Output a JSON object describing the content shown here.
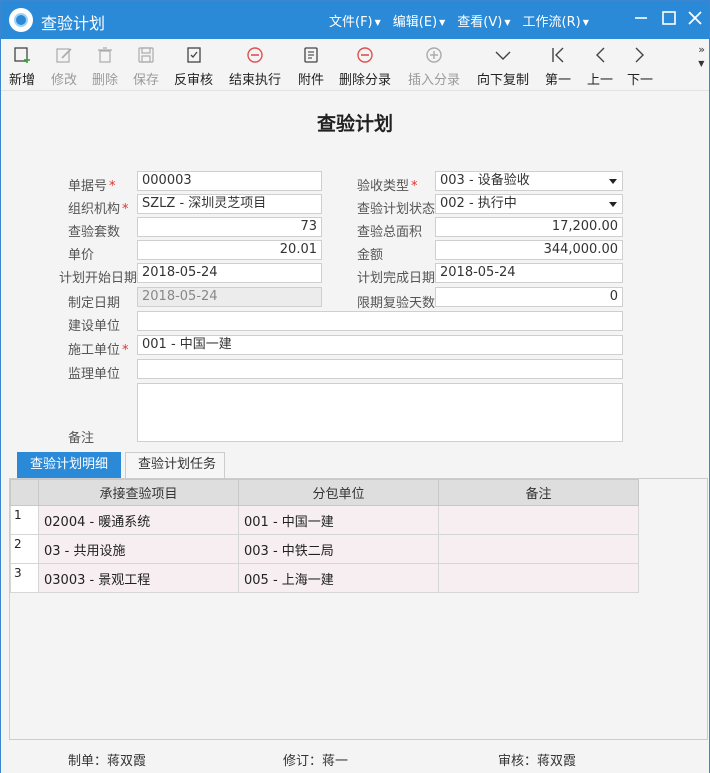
{
  "window": {
    "title": "查验计划"
  },
  "menu": [
    {
      "label": "文件(F)"
    },
    {
      "label": "编辑(E)"
    },
    {
      "label": "查看(V)"
    },
    {
      "label": "工作流(R)"
    }
  ],
  "toolbar": {
    "new": "新增",
    "edit": "修改",
    "delete": "删除",
    "save": "保存",
    "unaudit": "反审核",
    "end_exec": "结束执行",
    "attachment": "附件",
    "delete_entry": "删除分录",
    "insert_entry": "插入分录",
    "copy_down": "向下复制",
    "first": "第一",
    "prev": "上一",
    "next": "下一",
    "more": "»"
  },
  "form": {
    "title": "查验计划",
    "labels": {
      "doc_no": "单据号",
      "org": "组织机构",
      "set_count": "查验套数",
      "unit_price": "单价",
      "plan_start": "计划开始日期",
      "made_date": "制定日期",
      "build_unit": "建设单位",
      "construct_unit": "施工单位",
      "supervise_unit": "监理单位",
      "remark": "备注",
      "accept_type": "验收类型",
      "plan_status": "查验计划状态",
      "total_area": "查验总面积",
      "amount": "金额",
      "plan_end": "计划完成日期",
      "recheck_days": "限期复验天数"
    },
    "required_mark": "*",
    "values": {
      "doc_no": "000003",
      "org": "SZLZ - 深圳灵芝项目",
      "set_count": "73",
      "unit_price": "20.01",
      "plan_start": "2018-05-24",
      "made_date": "2018-05-24",
      "build_unit": "",
      "construct_unit": "001 - 中国一建",
      "supervise_unit": "",
      "remark": "",
      "accept_type": "003 - 设备验收",
      "plan_status": "002 - 执行中",
      "total_area": "17,200.00",
      "amount": "344,000.00",
      "plan_end": "2018-05-24",
      "recheck_days": "0"
    }
  },
  "tabs": [
    {
      "label": "查验计划明细",
      "active": true
    },
    {
      "label": "查验计划任务",
      "active": false
    }
  ],
  "grid": {
    "columns": [
      "承接查验项目",
      "分包单位",
      "备注"
    ],
    "rows": [
      {
        "num": "1",
        "item": "02004 - 暖通系统",
        "sub": "001 - 中国一建",
        "remark": ""
      },
      {
        "num": "2",
        "item": "03 - 共用设施",
        "sub": "003 - 中铁二局",
        "remark": ""
      },
      {
        "num": "3",
        "item": "03003 - 景观工程",
        "sub": "005 - 上海一建",
        "remark": ""
      }
    ]
  },
  "footer": {
    "maker": "制单：蒋双霞",
    "reviser": "修订：蒋一",
    "auditor": "审核：蒋双霞"
  },
  "colors": {
    "accent": "#2b8ad8",
    "required": "#e03030",
    "row_bg": "#f6eef0",
    "header_bg": "#dedede"
  }
}
